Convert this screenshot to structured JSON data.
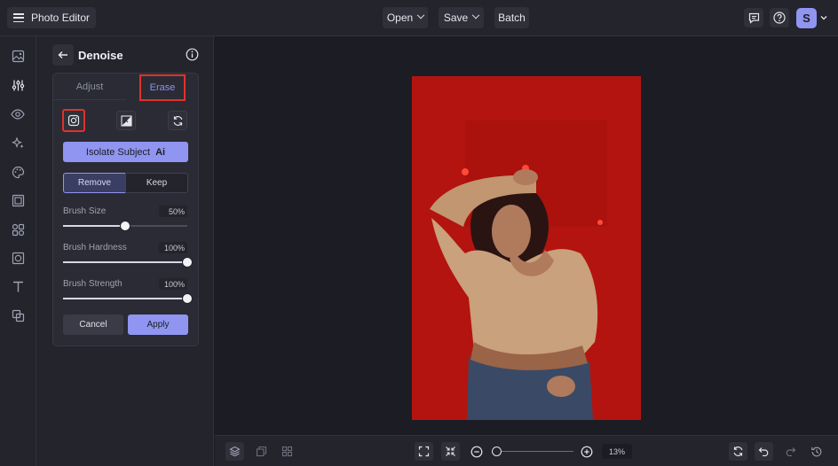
{
  "topbar": {
    "app_title": "Photo Editor",
    "open_label": "Open",
    "save_label": "Save",
    "batch_label": "Batch",
    "user_initial": "S"
  },
  "rail": {
    "icons": [
      "image-icon",
      "sliders-icon",
      "eye-icon",
      "sparkles-icon",
      "palette-icon",
      "frame-icon",
      "shapes-icon",
      "texture-icon",
      "text-icon",
      "overlay-icon"
    ]
  },
  "panel": {
    "title": "Denoise",
    "tabs": {
      "adjust": "Adjust",
      "erase": "Erase"
    },
    "isolate_label": "Isolate Subject",
    "isolate_badge": "Ai",
    "mode": {
      "remove": "Remove",
      "keep": "Keep",
      "selected": "Remove"
    },
    "sliders": [
      {
        "label": "Brush Size",
        "value": "50%",
        "level": 0.5
      },
      {
        "label": "Brush Hardness",
        "value": "100%",
        "level": 1.0
      },
      {
        "label": "Brush Strength",
        "value": "100%",
        "level": 1.0
      }
    ],
    "cancel_label": "Cancel",
    "apply_label": "Apply"
  },
  "bottom": {
    "zoom_value": "13%",
    "zoom_level": 0.0
  },
  "colors": {
    "accent": "#8f95f0",
    "highlight_border": "#e0322b",
    "photo_background": "#b3140f"
  }
}
